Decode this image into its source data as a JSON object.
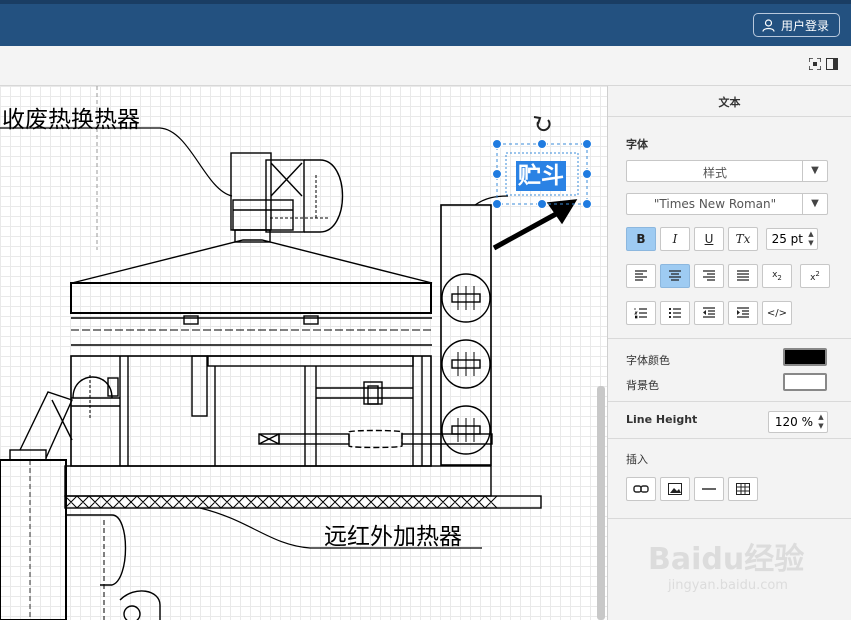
{
  "header": {
    "login_label": "用户登录"
  },
  "canvas": {
    "labels": {
      "heat_exchanger": "收废热换热器",
      "infrared_heater": "远红外加热器",
      "hopper_selected": "贮斗"
    }
  },
  "panel": {
    "title": "文本",
    "font_section": "字体",
    "style_dropdown": "样式",
    "font_dropdown": "\"Times New Roman\"",
    "font_size": "25 pt",
    "format_buttons": {
      "bold": "B",
      "italic": "I",
      "underline": "U",
      "clear": "Tx"
    },
    "font_color_label": "字体颜色",
    "font_color": "#000000",
    "bg_color_label": "背景色",
    "bg_color": "#ffffff",
    "line_height_label": "Line Height",
    "line_height": "120 %",
    "insert_label": "插入"
  },
  "watermark": {
    "brand": "Baidu经验",
    "url": "jingyan.baidu.com"
  }
}
